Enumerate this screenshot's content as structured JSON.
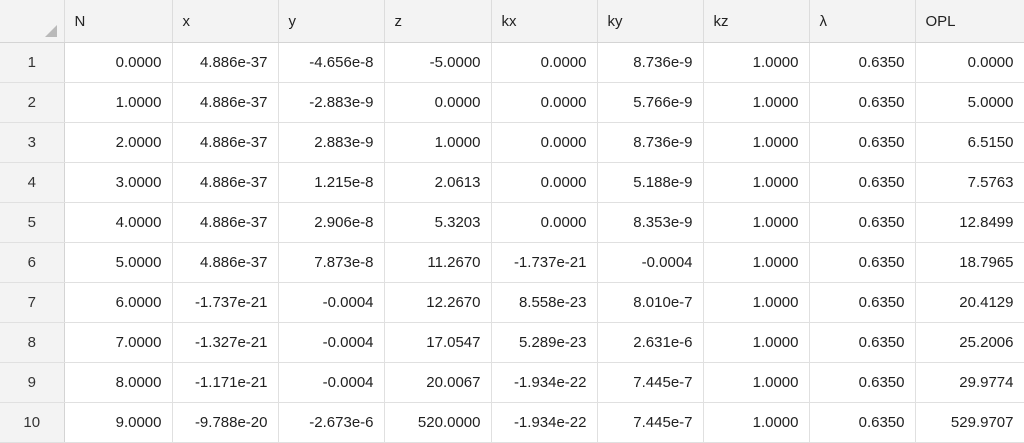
{
  "table": {
    "columns": [
      "N",
      "x",
      "y",
      "z",
      "kx",
      "ky",
      "kz",
      "λ",
      "OPL"
    ],
    "rows": [
      {
        "num": "1",
        "cells": [
          "0.0000",
          "4.886e-37",
          "-4.656e-8",
          "-5.0000",
          "0.0000",
          "8.736e-9",
          "1.0000",
          "0.6350",
          "0.0000"
        ]
      },
      {
        "num": "2",
        "cells": [
          "1.0000",
          "4.886e-37",
          "-2.883e-9",
          "0.0000",
          "0.0000",
          "5.766e-9",
          "1.0000",
          "0.6350",
          "5.0000"
        ]
      },
      {
        "num": "3",
        "cells": [
          "2.0000",
          "4.886e-37",
          "2.883e-9",
          "1.0000",
          "0.0000",
          "8.736e-9",
          "1.0000",
          "0.6350",
          "6.5150"
        ]
      },
      {
        "num": "4",
        "cells": [
          "3.0000",
          "4.886e-37",
          "1.215e-8",
          "2.0613",
          "0.0000",
          "5.188e-9",
          "1.0000",
          "0.6350",
          "7.5763"
        ]
      },
      {
        "num": "5",
        "cells": [
          "4.0000",
          "4.886e-37",
          "2.906e-8",
          "5.3203",
          "0.0000",
          "8.353e-9",
          "1.0000",
          "0.6350",
          "12.8499"
        ]
      },
      {
        "num": "6",
        "cells": [
          "5.0000",
          "4.886e-37",
          "7.873e-8",
          "11.2670",
          "-1.737e-21",
          "-0.0004",
          "1.0000",
          "0.6350",
          "18.7965"
        ]
      },
      {
        "num": "7",
        "cells": [
          "6.0000",
          "-1.737e-21",
          "-0.0004",
          "12.2670",
          "8.558e-23",
          "8.010e-7",
          "1.0000",
          "0.6350",
          "20.4129"
        ]
      },
      {
        "num": "8",
        "cells": [
          "7.0000",
          "-1.327e-21",
          "-0.0004",
          "17.0547",
          "5.289e-23",
          "2.631e-6",
          "1.0000",
          "0.6350",
          "25.2006"
        ]
      },
      {
        "num": "9",
        "cells": [
          "8.0000",
          "-1.171e-21",
          "-0.0004",
          "20.0067",
          "-1.934e-22",
          "7.445e-7",
          "1.0000",
          "0.6350",
          "29.9774"
        ]
      },
      {
        "num": "10",
        "cells": [
          "9.0000",
          "-9.788e-20",
          "-2.673e-6",
          "520.0000",
          "-1.934e-22",
          "7.445e-7",
          "1.0000",
          "0.6350",
          "529.9707"
        ]
      }
    ]
  }
}
